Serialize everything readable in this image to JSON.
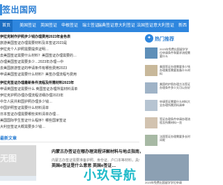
{
  "site": {
    "name": "签出国网"
  },
  "nav": {
    "items": [
      {
        "label": "首页"
      },
      {
        "label": "美国签证"
      },
      {
        "label": "英国签证"
      },
      {
        "label": "申根签证"
      },
      {
        "label": "瑞士签证"
      },
      {
        "label": "瑞典签证"
      },
      {
        "label": "意大利签证"
      },
      {
        "label": "法国签证"
      },
      {
        "label": "意大利签证"
      },
      {
        "label": "新西"
      }
    ]
  },
  "news": {
    "lines": [
      {
        "text": "伊拉克制作护照步少钱办理费用2023年金色表"
      },
      {
        "text": "旅游美国签证办理需要材料及本签证2023是"
      },
      {
        "text": "伊拉克个人护照需要提供证明…"
      },
      {
        "text": "去美国签证需要什么材料？美国签证办理需要的…"
      },
      {
        "text": "办理美国签证需要多少…2023年办理—中"
      },
      {
        "text": "去美国旅游签证的申请条件有哪些费用2023"
      },
      {
        "text": "申请美国签证需要什么材料？美签办理流程与费用"
      },
      {
        "text": "伊拉克签证办理最新条件流程及所需材料2023年"
      },
      {
        "text": "申请英国签证需要什么 英国签证办理所需材料清单"
      },
      {
        "text": "伊拉克护照办理办理流程详细办理2023年"
      },
      {
        "text": "中华人民共和国护照办理多少钱…"
      },
      {
        "text": "中国护照签证需要什么材料清单"
      },
      {
        "text": "日本签证办理需要哪些资料清单办理…"
      },
      {
        "text": "美国国际学生签证什么程序？哪些国家签证"
      },
      {
        "text": "大利亚签证大概需要多少钱…"
      }
    ]
  },
  "latest": {
    "title": "最新文章",
    "articles": [
      {
        "thumb_text": "无图",
        "title": "内蒙古办签证在哪办理流程详解材料与地点指南，内蒙古地…",
        "excerpt": "内蒙古办签证需要准备护照、身份证、户口本等材料，具体办理流程为..."
      },
      {
        "title": "英国e签证是什么意思 英国e签证…"
      }
    ]
  },
  "watermark": {
    "text": "小玖导航"
  },
  "sidebar": {
    "hot_title": "热门推荐",
    "hot_icon": "fire-icon",
    "items": [
      {
        "text": "2023年免费出国留学学位申请条件和要求流程需要什么"
      },
      {
        "text": "美国签证办理需要多少钱办理美签需要准备什么材料"
      },
      {
        "text": "美国的护照办理方法签证办理条件多少天可以办好"
      },
      {
        "text": "申请签证需要什么材料大全办理所需资料清单"
      },
      {
        "text": "签证办理条件申请办理流程及所需材料一览"
      },
      {
        "text": "法国签证办理需要多长时间呢"
      }
    ],
    "bottom_caption": "2023年免费出国留学学位申请"
  },
  "colors": {
    "accent": "#2e86de",
    "watermark": "#16b8c8"
  }
}
